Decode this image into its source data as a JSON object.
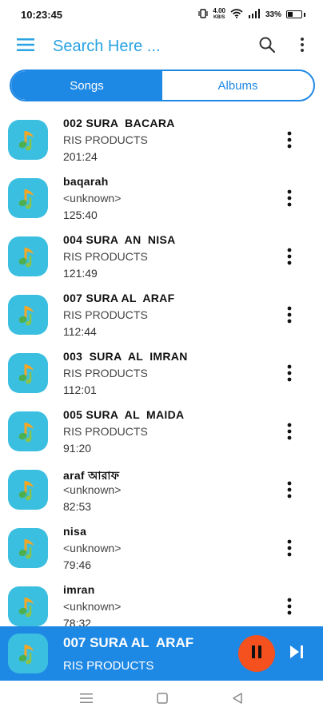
{
  "status_bar": {
    "time": "10:23:45",
    "speed_top": "4.00",
    "speed_bottom": "KB/S",
    "battery": "33%"
  },
  "appbar": {
    "search_placeholder": "Search Here ...",
    "menu_icon": "hamburger-menu-icon",
    "search_icon": "search-icon",
    "overflow_icon": "vertical-dots-icon"
  },
  "tabs": [
    {
      "label": "Songs",
      "active": true
    },
    {
      "label": "Albums",
      "active": false
    }
  ],
  "songs": [
    {
      "title": "002 SURA  BACARA",
      "artist": "RIS PRODUCTS",
      "duration": "201:24"
    },
    {
      "title": "baqarah",
      "artist": "<unknown>",
      "duration": "125:40"
    },
    {
      "title": "004 SURA  AN  NISA",
      "artist": "RIS PRODUCTS",
      "duration": "121:49"
    },
    {
      "title": "007 SURA AL  ARAF",
      "artist": "RIS PRODUCTS",
      "duration": "112:44"
    },
    {
      "title": "003  SURA  AL  IMRAN",
      "artist": "RIS PRODUCTS",
      "duration": "112:01"
    },
    {
      "title": "005 SURA  AL  MAIDA",
      "artist": "RIS PRODUCTS",
      "duration": "91:20"
    },
    {
      "title": "araf আরাফ",
      "artist": "<unknown>",
      "duration": "82:53"
    },
    {
      "title": "nisa",
      "artist": "<unknown>",
      "duration": "79:46"
    },
    {
      "title": "imran",
      "artist": "<unknown>",
      "duration": "78:32"
    }
  ],
  "player": {
    "title": "007 SURA AL  ARAF",
    "artist": "RIS PRODUCTS",
    "state": "playing"
  },
  "colors": {
    "accent": "#1e88e5",
    "search_text": "#29a3e3",
    "thumb_bg": "#3bbfe0",
    "pause_bg": "#f4511e"
  }
}
